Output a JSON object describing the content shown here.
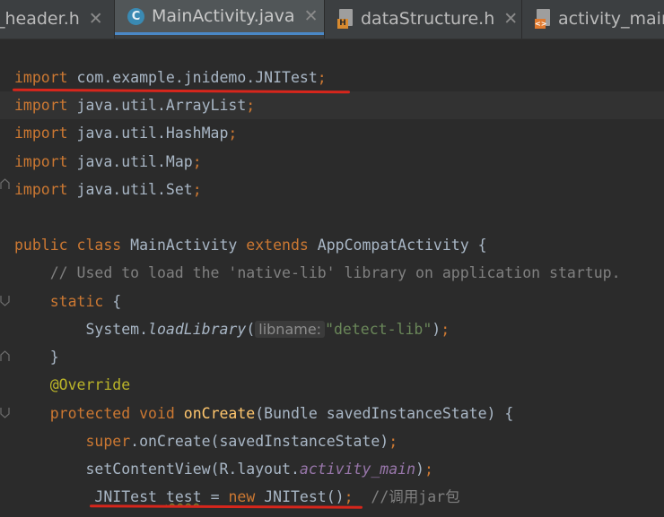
{
  "tabs": [
    {
      "label": "_header.h",
      "icon": "header-file-icon",
      "active": false
    },
    {
      "label": "MainActivity.java",
      "icon": "java-class-icon",
      "active": true
    },
    {
      "label": "dataStructure.h",
      "icon": "header-file-icon",
      "active": false
    },
    {
      "label": "activity_main",
      "icon": "xml-layout-icon",
      "active": false
    }
  ],
  "tab_close_symbol": "✕",
  "icon_badges": {
    "class": "C",
    "header": "H",
    "xml": "<>"
  },
  "code": {
    "l1": {
      "kw": "import",
      "rest": " com.example.jnidemo.JNITest",
      "semi": ";"
    },
    "l2": {
      "kw": "import",
      "rest": " java.util.ArrayList",
      "semi": ";"
    },
    "l3": {
      "kw": "import",
      "rest": " java.util.HashMap",
      "semi": ";"
    },
    "l4": {
      "kw": "import",
      "rest": " java.util.Map",
      "semi": ";"
    },
    "l5": {
      "kw": "import",
      "rest": " java.util.Set",
      "semi": ";"
    },
    "l7": {
      "kw1": "public class",
      "name": " MainActivity ",
      "kw2": "extends",
      "rest": " AppCompatActivity {"
    },
    "l8": {
      "comment": "    // Used to load the 'native-lib' library on application startup."
    },
    "l9": {
      "indent": "    ",
      "kw": "static",
      "rest": " {"
    },
    "l10": {
      "indent": "        ",
      "obj": "System.",
      "method": "loadLibrary",
      "paren": "(",
      "hint": "libname:",
      "str": "\"detect-lib\"",
      "close": ")",
      "semi": ";"
    },
    "l11": {
      "text": "    }"
    },
    "l12": {
      "indent": "    ",
      "annotation": "@Override"
    },
    "l13": {
      "indent": "    ",
      "kw": "protected void",
      "sp": " ",
      "fn": "onCreate",
      "rest": "(Bundle savedInstanceState) {"
    },
    "l14": {
      "indent": "        ",
      "kw": "super",
      "rest": ".onCreate(savedInstanceState)",
      "semi": ";"
    },
    "l15": {
      "indent": "        ",
      "pre": "setContentView(R.layout.",
      "field": "activity_main",
      "post": ")",
      "semi": ";"
    },
    "l16": {
      "indent": "         ",
      "type": "JNITest ",
      "var": "test",
      "eq": " = ",
      "kw": "new",
      "ctor": " JNITest()",
      "semi": ";",
      "comment": "  //调用jar包"
    }
  },
  "colors": {
    "keyword": "#CC7832",
    "comment": "#808080",
    "string": "#6A8759",
    "annotation": "#BBB529",
    "method": "#FFC66D",
    "field": "#9876AA",
    "underline": "#D7261C",
    "tab_accent": "#4A88C7"
  }
}
